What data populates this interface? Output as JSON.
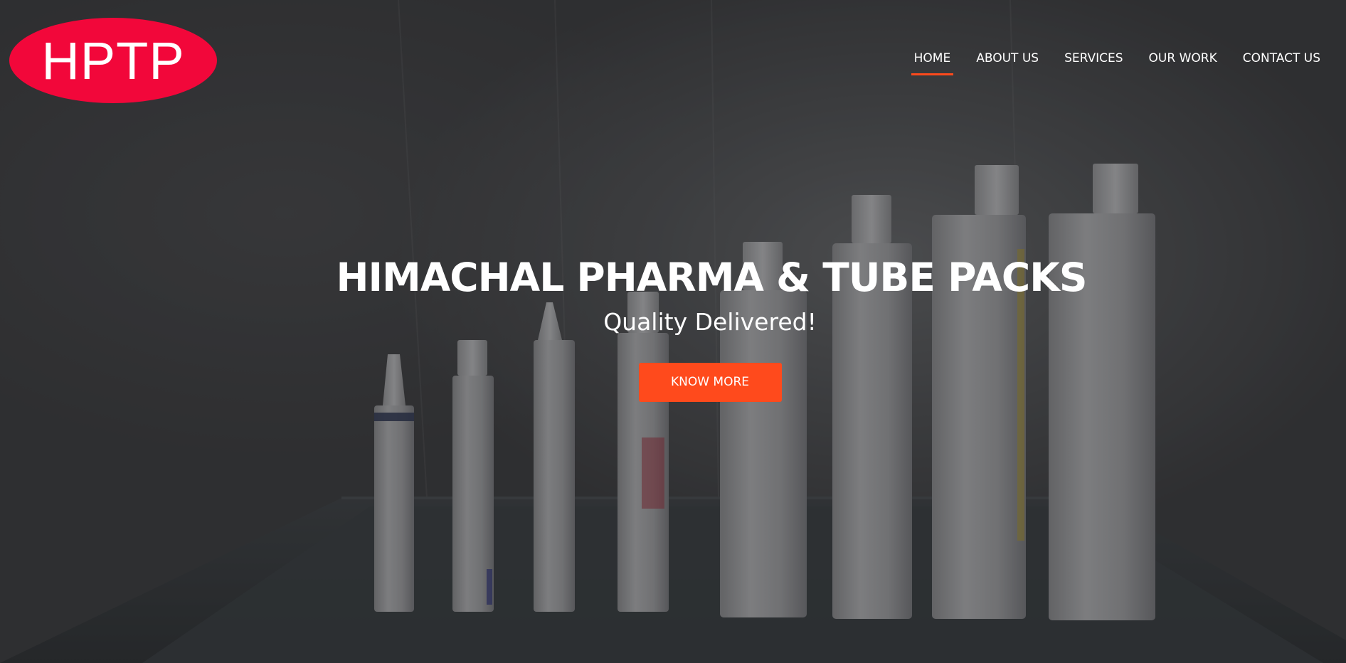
{
  "logo": {
    "text": "HPTP"
  },
  "nav": {
    "items": [
      {
        "label": "HOME",
        "active": true
      },
      {
        "label": "ABOUT US",
        "active": false
      },
      {
        "label": "SERVICES",
        "active": false
      },
      {
        "label": "OUR WORK",
        "active": false
      },
      {
        "label": "CONTACT US",
        "active": false
      }
    ]
  },
  "hero": {
    "title": "HIMACHAL PHARMA & TUBE PACKS",
    "subtitle": "Quality Delivered!",
    "button_label": "KNOW MORE"
  },
  "colors": {
    "logo_background": "#f2073a",
    "accent": "#ff4a1c",
    "text": "#ffffff"
  }
}
